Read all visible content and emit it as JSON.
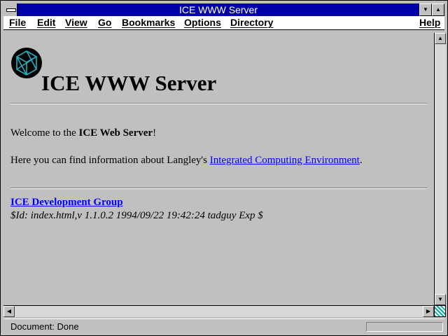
{
  "window": {
    "title": "ICE WWW Server",
    "minimize_glyph": "▼",
    "maximize_glyph": "▲"
  },
  "menu": {
    "file": "File",
    "edit": "Edit",
    "view": "View",
    "go": "Go",
    "bookmarks": "Bookmarks",
    "options": "Options",
    "directory": "Directory",
    "help": "Help"
  },
  "page": {
    "heading": "ICE WWW Server",
    "welcome_prefix": "Welcome to the ",
    "welcome_bold": "ICE Web Server",
    "welcome_suffix": "!",
    "info_prefix": "Here you can find information about Langley's ",
    "info_link": "Integrated Computing Environment",
    "info_suffix": ".",
    "group_link": "ICE Development Group",
    "rcs_id": "$Id: index.html,v 1.1.0.2 1994/09/22 19:42:24 tadguy Exp $"
  },
  "status": {
    "text": "Document: Done"
  },
  "icons": {
    "logo": "ice-cube-logo-icon",
    "scroll_up": "▲",
    "scroll_down": "▼",
    "scroll_left": "◀",
    "scroll_right": "▶"
  },
  "colors": {
    "titlebar": "#0000a8",
    "link": "#0000ff",
    "logo": "#20b0c0"
  }
}
